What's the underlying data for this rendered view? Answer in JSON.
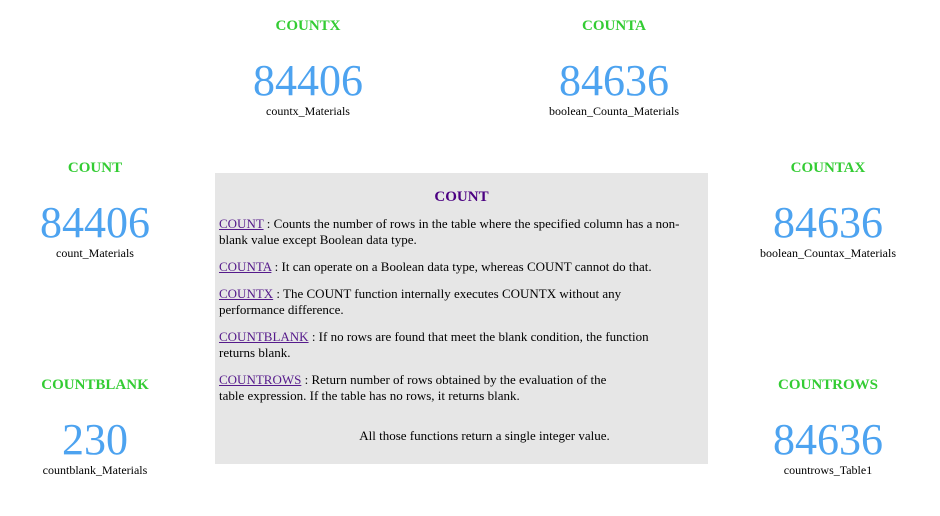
{
  "cards": {
    "countx": {
      "title": "COUNTX",
      "value": "84406",
      "label": "countx_Materials"
    },
    "counta": {
      "title": "COUNTA",
      "value": "84636",
      "label": "boolean_Counta_Materials"
    },
    "count": {
      "title": "COUNT",
      "value": "84406",
      "label": "count_Materials"
    },
    "countax": {
      "title": "COUNTAX",
      "value": "84636",
      "label": "boolean_Countax_Materials"
    },
    "countblank": {
      "title": "COUNTBLANK",
      "value": "230",
      "label": "countblank_Materials"
    },
    "countrows": {
      "title": "COUNTROWS",
      "value": "84636",
      "label": "countrows_Table1"
    }
  },
  "info": {
    "title": "COUNT",
    "items": [
      {
        "link": "COUNT",
        "text": " : Counts the number of rows in the table where the specified column has a non-blank value except Boolean data type."
      },
      {
        "link": "COUNTA",
        "text": " :  It can operate on a Boolean data type, whereas COUNT cannot do that."
      },
      {
        "link": "COUNTX",
        "text": " : The COUNT function internally executes COUNTX without any performance difference."
      },
      {
        "link": "COUNTBLANK",
        "text": " : If no rows are found that meet the blank condition, the function returns blank."
      },
      {
        "link": "COUNTROWS",
        "text": " :  Return number of rows obtained by the evaluation of the table expression. If the table has no rows, it returns blank."
      }
    ],
    "footer": "All those functions return a single integer value."
  },
  "colors": {
    "card_title": "#33cc33",
    "card_value": "#4da3f0",
    "panel_background": "#e6e6e6",
    "panel_title": "#4b0082",
    "link": "#551a8b"
  }
}
